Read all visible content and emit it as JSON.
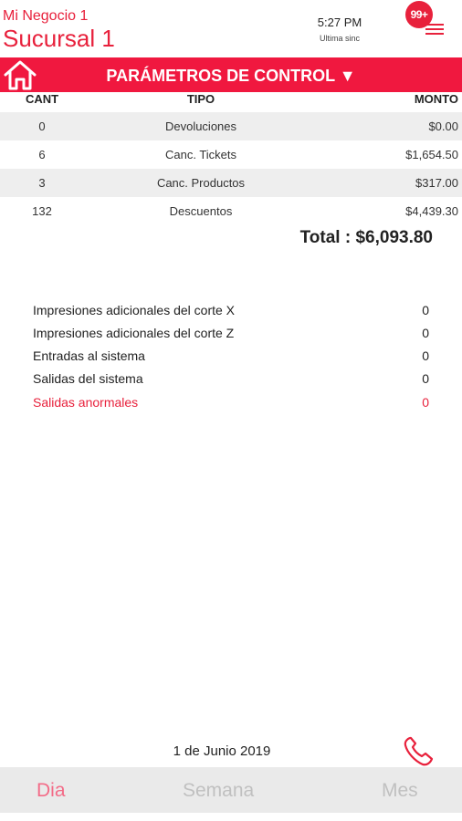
{
  "header": {
    "business": "Mi Negocio 1",
    "branch": "Sucursal 1",
    "time": "5:27 PM",
    "sync_label": "Ultima sinc",
    "badge": "99+"
  },
  "control_bar": {
    "title": "PARÁMETROS DE CONTROL ▼"
  },
  "table": {
    "headers": {
      "qty": "CANT",
      "type": "TIPO",
      "amount": "MONTO"
    },
    "rows": [
      {
        "qty": "0",
        "type": "Devoluciones",
        "amount": "$0.00"
      },
      {
        "qty": "6",
        "type": "Canc. Tickets",
        "amount": "$1,654.50"
      },
      {
        "qty": "3",
        "type": "Canc. Productos",
        "amount": "$317.00"
      },
      {
        "qty": "132",
        "type": "Descuentos",
        "amount": "$4,439.30"
      }
    ],
    "total": "Total : $6,093.80"
  },
  "stats": [
    {
      "label": "Impresiones adicionales del corte X",
      "value": "0"
    },
    {
      "label": "Impresiones adicionales del corte Z",
      "value": "0"
    },
    {
      "label": "Entradas al sistema",
      "value": "0"
    },
    {
      "label": "Salidas del sistema",
      "value": "0"
    },
    {
      "label": "Salidas anormales",
      "value": "0"
    }
  ],
  "footer": {
    "date": "1 de Junio 2019"
  },
  "tabs": {
    "day": "Dia",
    "week": "Semana",
    "month": "Mes",
    "active": "Dia"
  },
  "colors": {
    "accent": "#f0183f",
    "active_tab": "#f36b87",
    "inactive_tab": "#c0c0c0"
  }
}
